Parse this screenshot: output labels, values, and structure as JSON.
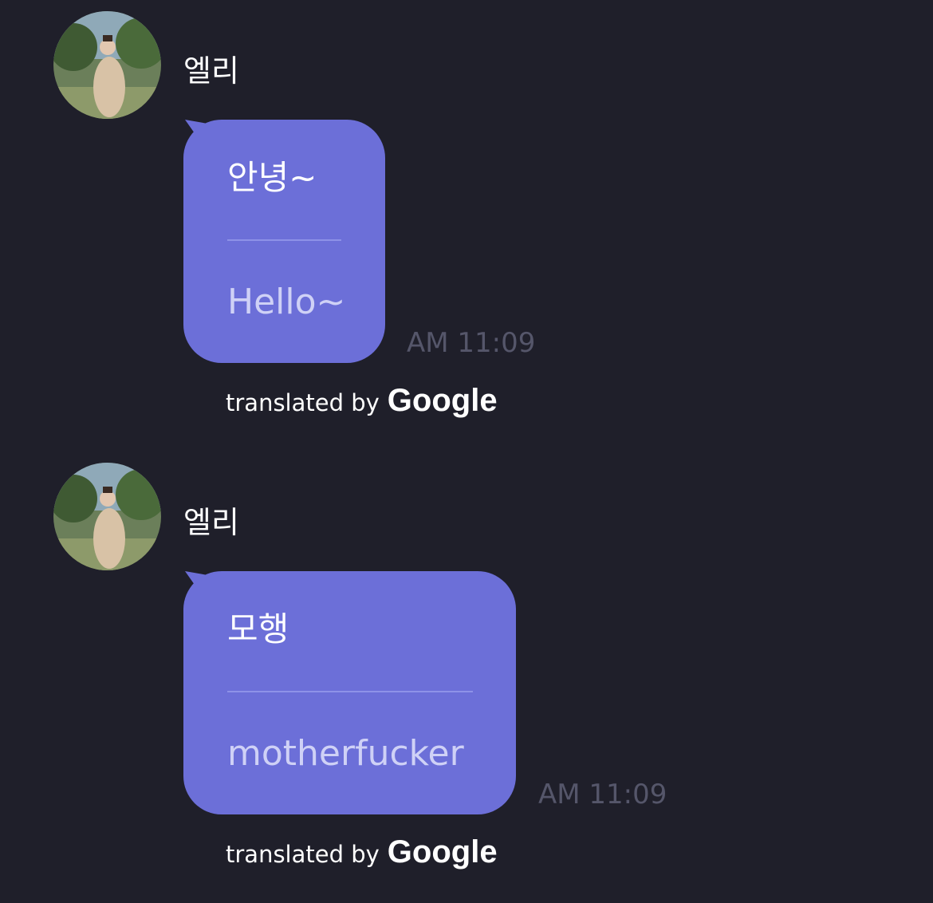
{
  "messages": [
    {
      "sender": "엘리",
      "original": "안녕~",
      "translation": "Hello~",
      "time": "AM 11:09",
      "credit_prefix": "translated by",
      "credit_brand": "Google"
    },
    {
      "sender": "엘리",
      "original": "모행",
      "translation": "motherfucker",
      "time": "AM 11:09",
      "credit_prefix": "translated by",
      "credit_brand": "Google"
    }
  ],
  "colors": {
    "background": "#1f1f2a",
    "bubble": "#6c6fd8",
    "timestamp": "#55566a"
  },
  "icons": {
    "avatar": "profile-photo-avatar"
  }
}
